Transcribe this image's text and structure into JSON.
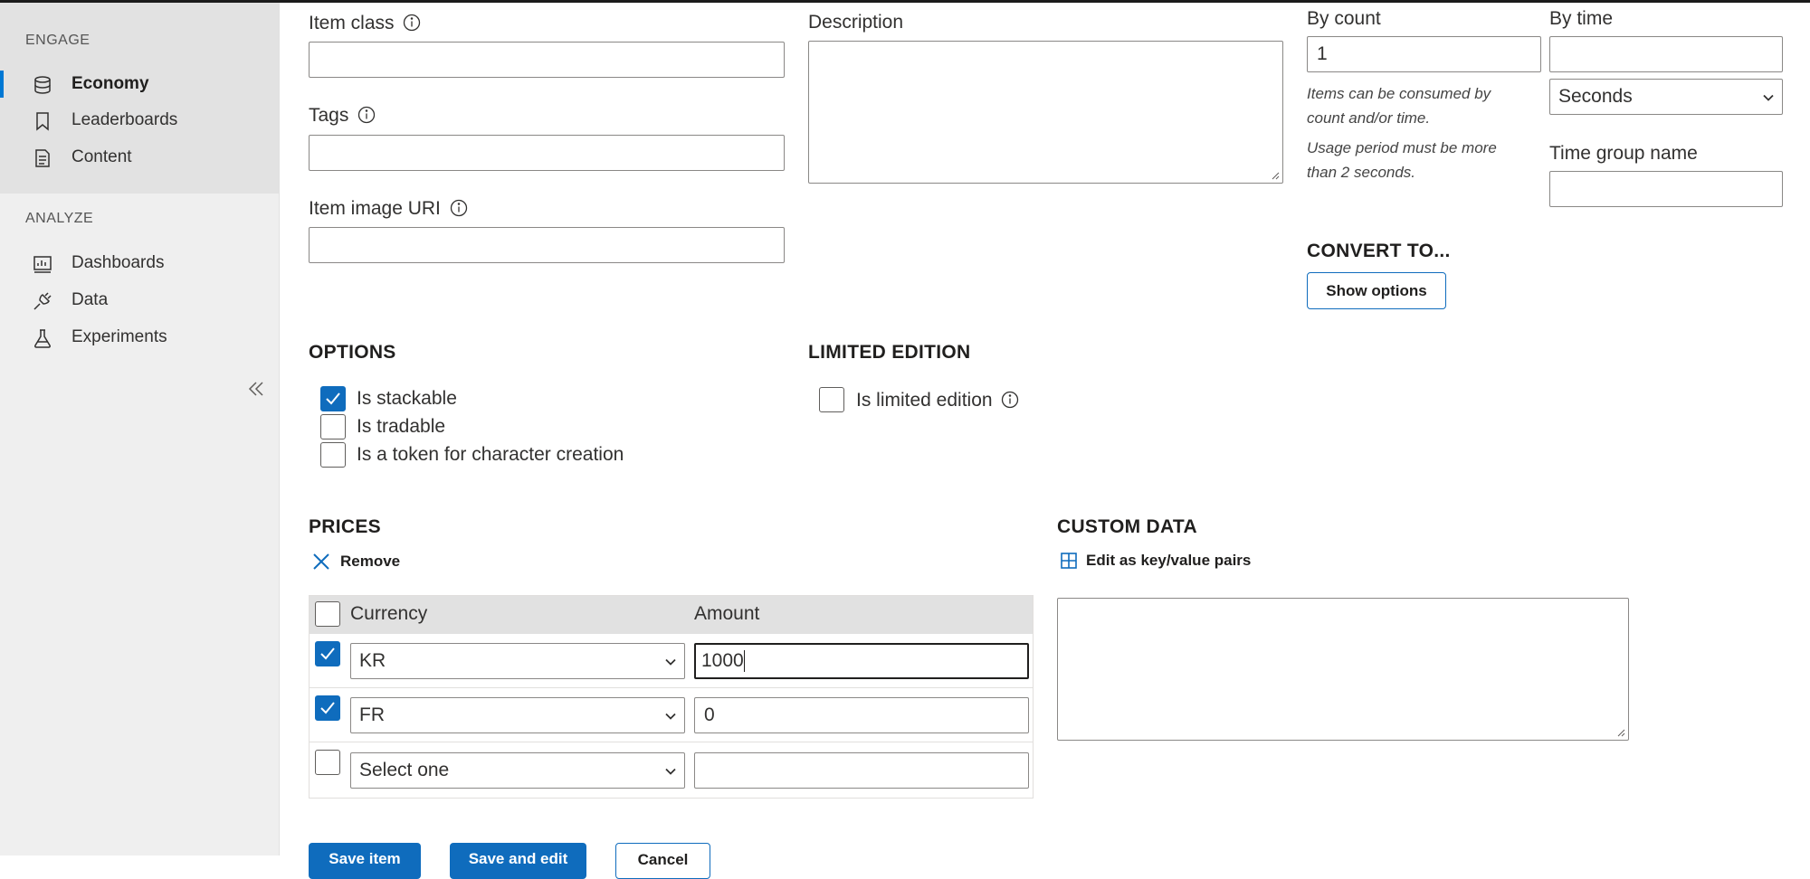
{
  "sidebar": {
    "engage_label": "ENGAGE",
    "engage_items": [
      {
        "label": "Economy",
        "icon": "database-icon",
        "active": true
      },
      {
        "label": "Leaderboards",
        "icon": "bookmark-icon"
      },
      {
        "label": "Content",
        "icon": "document-icon"
      }
    ],
    "analyze_label": "ANALYZE",
    "analyze_items": [
      {
        "label": "Dashboards",
        "icon": "dashboard-icon"
      },
      {
        "label": "Data",
        "icon": "plug-icon"
      },
      {
        "label": "Experiments",
        "icon": "flask-icon"
      }
    ],
    "collapse_icon": "double-chevron-left-icon"
  },
  "form": {
    "item_class": {
      "label": "Item class",
      "value": ""
    },
    "tags": {
      "label": "Tags",
      "value": ""
    },
    "item_image_uri": {
      "label": "Item image URI",
      "value": ""
    },
    "description": {
      "label": "Description",
      "value": ""
    },
    "by_count": {
      "label": "By count",
      "value": "1"
    },
    "by_time": {
      "label": "By time",
      "value": ""
    },
    "time_unit": {
      "selected": "Seconds"
    },
    "hint_consume": "Items can be consumed by count and/or time.",
    "hint_usage": "Usage period must be more than 2 seconds.",
    "time_group_name": {
      "label": "Time group name",
      "value": ""
    },
    "convert_to": {
      "heading": "CONVERT TO...",
      "button": "Show options"
    }
  },
  "options": {
    "heading": "OPTIONS",
    "items": [
      {
        "label": "Is stackable",
        "checked": true
      },
      {
        "label": "Is tradable",
        "checked": false
      },
      {
        "label": "Is a token for character creation",
        "checked": false
      }
    ]
  },
  "limited_edition": {
    "heading": "LIMITED EDITION",
    "label": "Is limited edition",
    "checked": false
  },
  "prices": {
    "heading": "PRICES",
    "remove_label": "Remove",
    "columns": {
      "currency": "Currency",
      "amount": "Amount"
    },
    "rows": [
      {
        "checked": true,
        "currency": "KR",
        "amount": "1000"
      },
      {
        "checked": true,
        "currency": "FR",
        "amount": "0"
      },
      {
        "checked": false,
        "currency": "Select one",
        "amount": ""
      }
    ]
  },
  "custom_data": {
    "heading": "CUSTOM DATA",
    "edit_label": "Edit as key/value pairs",
    "value": ""
  },
  "footer": {
    "save_label": "Save item",
    "save_continue_label": "Save and edit",
    "cancel_label": "Cancel"
  },
  "colors": {
    "accent": "#0f6cbd",
    "sidebar_bg": "#efefef",
    "sidebar_engage_bg": "#e2e2e2",
    "table_header_bg": "#e1e1e1"
  }
}
